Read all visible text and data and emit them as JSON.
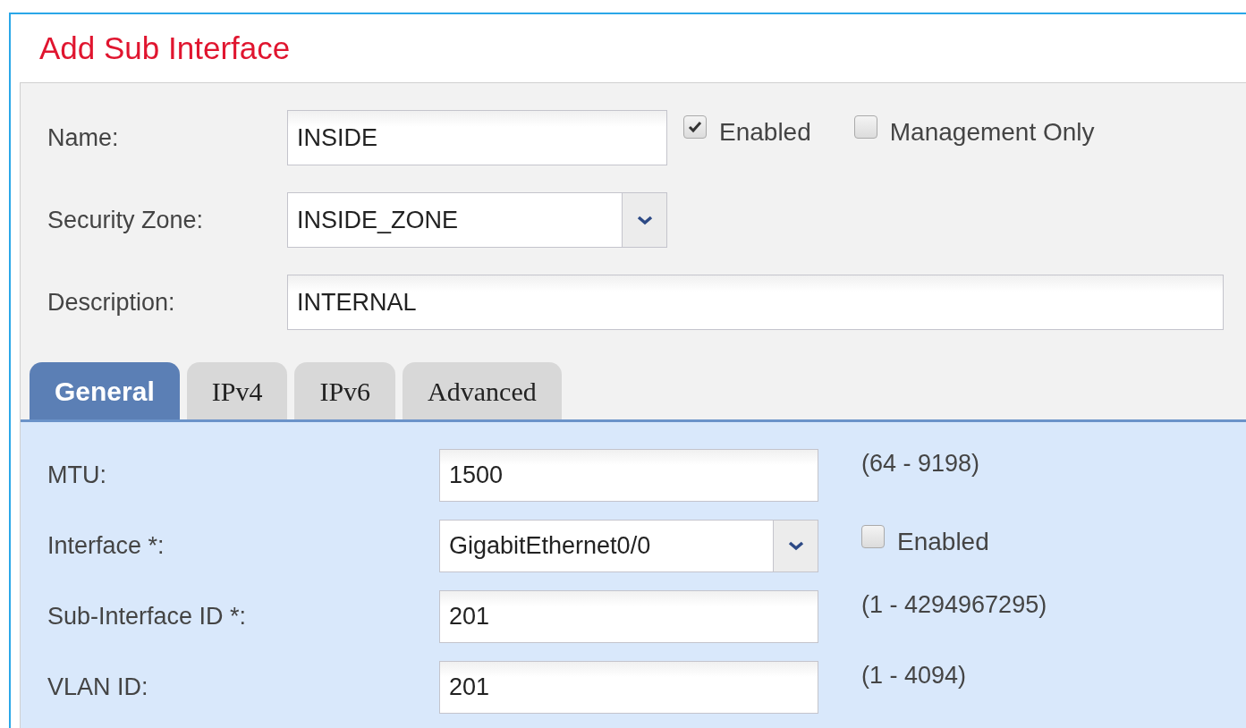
{
  "dialog": {
    "title": "Add Sub Interface"
  },
  "fields": [
    {
      "kind": "text",
      "label": "Name:",
      "value": "INSIDE",
      "checkboxes": [
        {
          "label": "Enabled",
          "checked": true
        },
        {
          "label": "Management Only",
          "checked": false
        }
      ]
    },
    {
      "kind": "select",
      "label": "Security Zone:",
      "value": "INSIDE_ZONE"
    },
    {
      "kind": "wide",
      "label": "Description:",
      "value": "INTERNAL"
    }
  ],
  "tabs": [
    {
      "label": "General",
      "selected": true
    },
    {
      "label": "IPv4",
      "selected": false
    },
    {
      "label": "IPv6",
      "selected": false
    },
    {
      "label": "Advanced",
      "selected": false
    }
  ],
  "general_fields": [
    {
      "kind": "text",
      "label": "MTU:",
      "value": "1500",
      "hint": "(64 - 9198)"
    },
    {
      "kind": "select",
      "label": "Interface *:",
      "value": "GigabitEthernet0/0",
      "checkbox": {
        "label": "Enabled",
        "checked": false
      }
    },
    {
      "kind": "text",
      "label": "Sub-Interface ID *:",
      "value": "201",
      "hint": "(1 - 4294967295)"
    },
    {
      "kind": "text",
      "label": "VLAN ID:",
      "value": "201",
      "hint": "(1 - 4094)"
    }
  ]
}
